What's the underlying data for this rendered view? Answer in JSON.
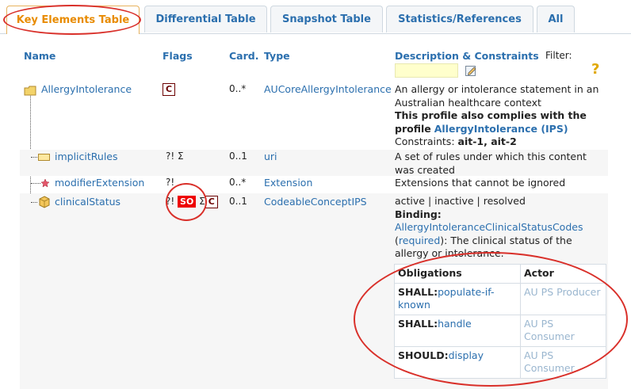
{
  "tabs": [
    {
      "label": "Key Elements Table",
      "active": true
    },
    {
      "label": "Differential Table",
      "active": false
    },
    {
      "label": "Snapshot Table",
      "active": false
    },
    {
      "label": "Statistics/References",
      "active": false
    },
    {
      "label": "All",
      "active": false
    }
  ],
  "header": {
    "name": "Name",
    "flags": "Flags",
    "card": "Card.",
    "type": "Type",
    "desc": "Description & Constraints",
    "filter": "Filter:"
  },
  "rows": {
    "r1": {
      "name": "AllergyIntolerance",
      "flag_c": "C",
      "card": "0..*",
      "type": "AUCoreAllergyIntolerance",
      "desc_line1": "An allergy or intolerance statement in an Australian healthcare context",
      "desc_bold": "This profile also complies with the profile",
      "desc_link": "AllergyIntolerance (IPS)",
      "constraints_label": "Constraints:",
      "constraints_value": "ait-1, ait-2"
    },
    "r2": {
      "name": "implicitRules",
      "flags": "?! Σ",
      "card": "0..1",
      "type": "uri",
      "desc": "A set of rules under which this content was created"
    },
    "r3": {
      "name": "modifierExtension",
      "flags": "?!",
      "card": "0..*",
      "type": "Extension",
      "desc": "Extensions that cannot be ignored"
    },
    "r4": {
      "name": "clinicalStatus",
      "flag_mod": "?!",
      "flag_so": "SO",
      "flag_sigma": "Σ",
      "flag_c": "C",
      "card": "0..1",
      "type": "CodeableConceptIPS",
      "desc_line1": "active | inactive | resolved",
      "binding_label": "Binding:",
      "binding_link": "AllergyIntoleranceClinicalStatusCodes",
      "open_paren": "(",
      "strength": "required",
      "binding_desc": "): The clinical status of the allergy or intolerance."
    }
  },
  "obligations": {
    "col_obligations": "Obligations",
    "col_actor": "Actor",
    "items": [
      {
        "level": "SHALL:",
        "code": "populate-if-known",
        "actor": "AU PS Producer"
      },
      {
        "level": "SHALL:",
        "code": "handle",
        "actor": "AU PS Consumer"
      },
      {
        "level": "SHOULD:",
        "code": "display",
        "actor": "AU PS Consumer"
      }
    ]
  },
  "colors": {
    "link": "#2b6fae",
    "active_tab": "#e88b00",
    "annotation": "#d9302a",
    "flag_so": "#ee0000"
  }
}
